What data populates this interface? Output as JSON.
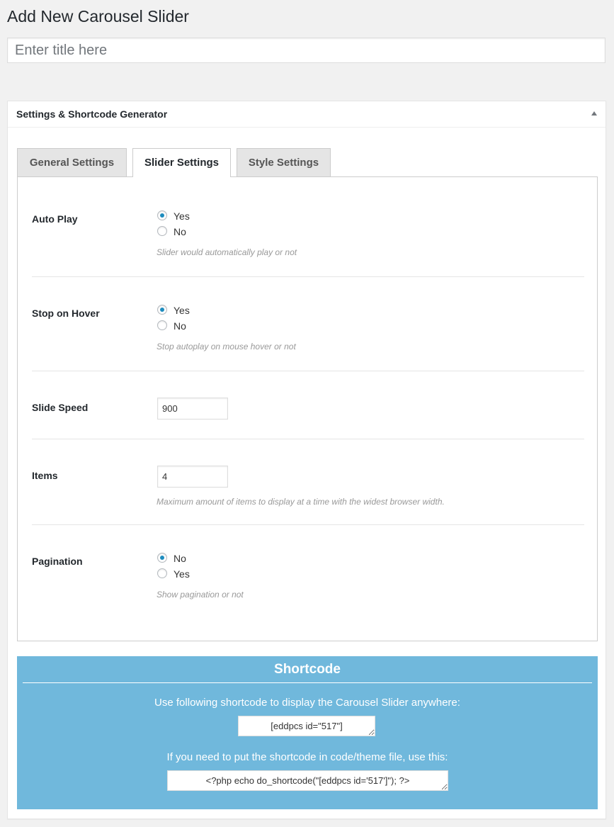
{
  "page": {
    "title": "Add New Carousel Slider"
  },
  "title_input": {
    "placeholder": "Enter title here",
    "value": ""
  },
  "postbox": {
    "title": "Settings & Shortcode Generator"
  },
  "tabs": [
    {
      "label": "General Settings",
      "active": false
    },
    {
      "label": "Slider Settings",
      "active": true
    },
    {
      "label": "Style Settings",
      "active": false
    }
  ],
  "settings": {
    "auto_play": {
      "label": "Auto Play",
      "options": [
        {
          "label": "Yes",
          "checked": true
        },
        {
          "label": "No",
          "checked": false
        }
      ],
      "description": "Slider would automatically play or not"
    },
    "stop_on_hover": {
      "label": "Stop on Hover",
      "options": [
        {
          "label": "Yes",
          "checked": true
        },
        {
          "label": "No",
          "checked": false
        }
      ],
      "description": "Stop autoplay on mouse hover or not"
    },
    "slide_speed": {
      "label": "Slide Speed",
      "value": "900"
    },
    "items": {
      "label": "Items",
      "value": "4",
      "description": "Maximum amount of items to display at a time with the widest browser width."
    },
    "pagination": {
      "label": "Pagination",
      "options": [
        {
          "label": "No",
          "checked": true
        },
        {
          "label": "Yes",
          "checked": false
        }
      ],
      "description": "Show pagination or not"
    }
  },
  "shortcode": {
    "title": "Shortcode",
    "text1": "Use following shortcode to display the Carousel Slider anywhere:",
    "code1": "[eddpcs id=\"517\"]",
    "text2": "If you need to put the shortcode in code/theme file, use this:",
    "code2": "<?php echo do_shortcode(\"[eddpcs id='517']\"); ?>"
  },
  "colors": {
    "accent": "#1e8cbe",
    "shortcode_bg": "#70b8dc",
    "page_bg": "#f1f1f1"
  }
}
